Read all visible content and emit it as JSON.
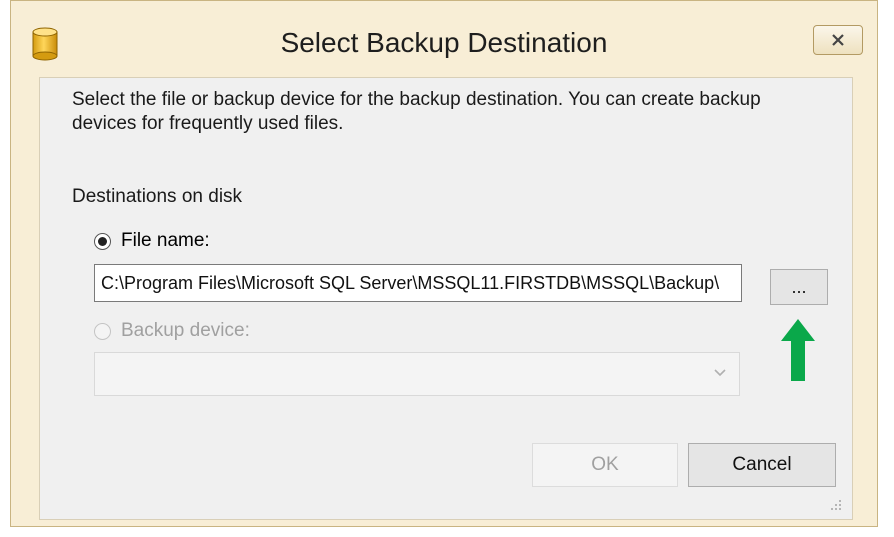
{
  "window": {
    "title": "Select Backup Destination",
    "close_label": "close"
  },
  "description": "Select the file or backup device for the backup destination. You can create backup devices for frequently used files.",
  "destinations": {
    "section_label": "Destinations on disk",
    "file_name_label": "File name:",
    "file_name_selected": true,
    "file_path": "C:\\Program Files\\Microsoft SQL Server\\MSSQL11.FIRSTDB\\MSSQL\\Backup\\",
    "browse_label": "...",
    "backup_device_label": "Backup device:",
    "backup_device_enabled": false,
    "backup_device_value": ""
  },
  "buttons": {
    "ok_label": "OK",
    "ok_enabled": false,
    "cancel_label": "Cancel"
  },
  "annotation": {
    "arrow_color": "#0aa84a",
    "arrow_icon": "arrow-up-icon"
  }
}
